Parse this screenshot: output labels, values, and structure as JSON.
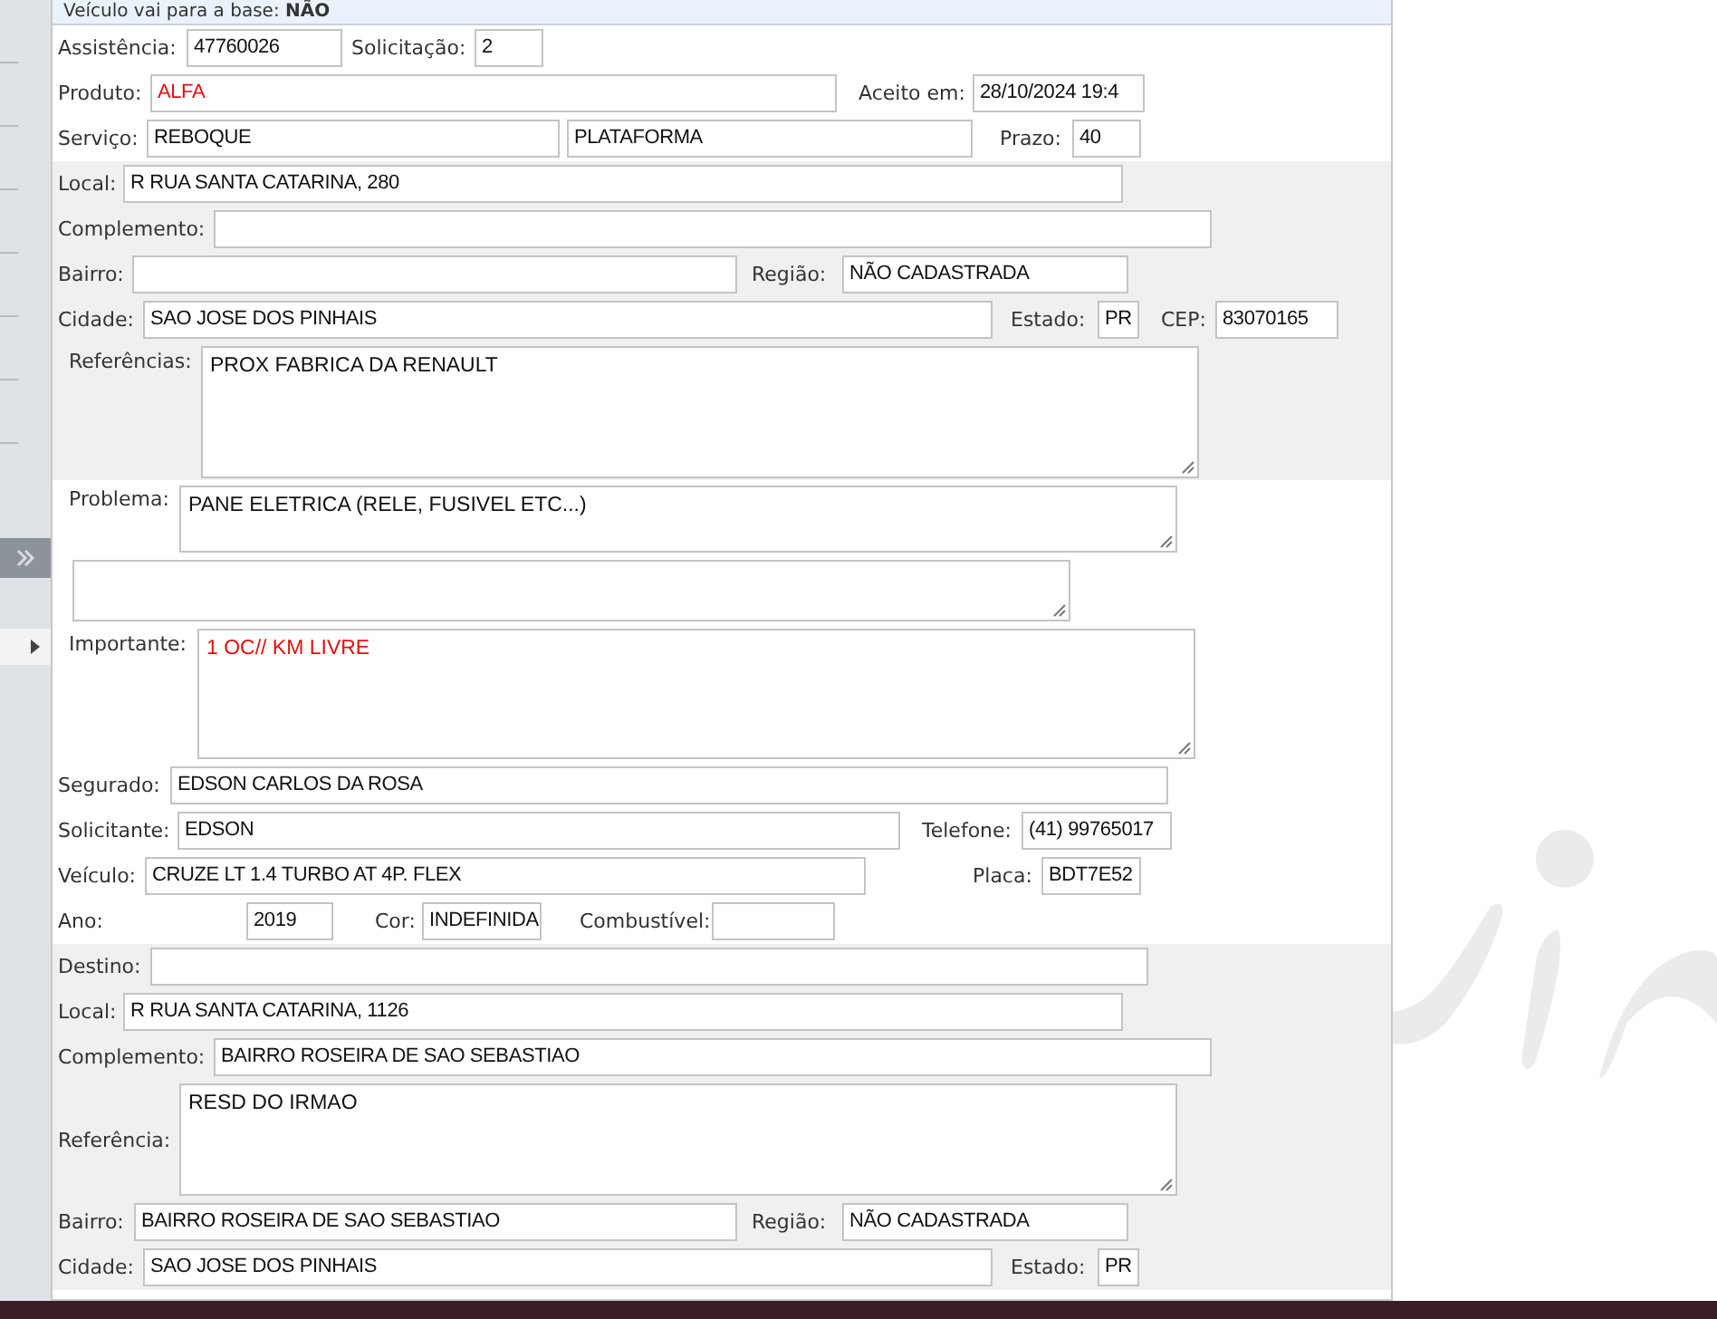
{
  "top_bar": {
    "label": "Veículo vai para a base:",
    "value": "NÃO"
  },
  "sections": [
    {
      "shaded": false,
      "rows": [
        {
          "fields": [
            {
              "label": "Assistência:",
              "value": "47760026",
              "kind": "input",
              "alert": false
            },
            {
              "label": "Solicitação:",
              "value": "2",
              "kind": "input",
              "alert": false
            }
          ]
        },
        {
          "fields": [
            {
              "label": "Produto:",
              "value": "ALFA",
              "kind": "input",
              "alert": true
            },
            {
              "label": "Aceito em:",
              "value": "28/10/2024 19:4",
              "kind": "input",
              "alert": false
            }
          ]
        },
        {
          "fields": [
            {
              "label": "Serviço:",
              "value": "REBOQUE",
              "kind": "input",
              "alert": false
            },
            {
              "value": "PLATAFORMA",
              "kind": "input",
              "alert": false
            },
            {
              "label": "Prazo:",
              "value": "40",
              "kind": "input",
              "alert": false
            }
          ]
        }
      ]
    },
    {
      "shaded": true,
      "rows": [
        {
          "fields": [
            {
              "label": "Local:",
              "value": "R RUA SANTA CATARINA, 280",
              "kind": "input",
              "alert": false
            }
          ]
        },
        {
          "fields": [
            {
              "label": "Complemento:",
              "kind": "input"
            }
          ]
        },
        {
          "fields": [
            {
              "label": "Bairro:",
              "kind": "input"
            },
            {
              "label": "Região:",
              "value": "NÃO CADASTRADA",
              "kind": "input",
              "alert": false
            }
          ]
        },
        {
          "fields": [
            {
              "label": "Cidade:",
              "value": "SAO JOSE DOS PINHAIS",
              "kind": "input",
              "alert": false
            },
            {
              "label": "Estado:",
              "value": "PR",
              "kind": "input",
              "alert": false
            },
            {
              "label": "CEP:",
              "value": "83070165",
              "kind": "input",
              "alert": false
            }
          ]
        },
        {
          "fields": [
            {
              "label": "Referências:",
              "value": "PROX FABRICA DA RENAULT",
              "kind": "textarea",
              "alert": false
            }
          ]
        }
      ]
    },
    {
      "shaded": false,
      "rows": [
        {
          "fields": [
            {
              "label": "Problema:",
              "value": "PANE ELETRICA (RELE, FUSIVEL ETC...)",
              "kind": "textarea",
              "alert": false
            }
          ]
        },
        {
          "fields": [
            {
              "kind": "textarea"
            }
          ]
        },
        {
          "fields": [
            {
              "label": "Importante:",
              "value": "1 OC// KM LIVRE",
              "kind": "textarea",
              "alert": true
            }
          ]
        },
        {
          "fields": [
            {
              "label": "Segurado:",
              "value": "EDSON CARLOS DA ROSA",
              "kind": "input",
              "alert": false
            }
          ]
        },
        {
          "fields": [
            {
              "label": "Solicitante:",
              "value": "EDSON",
              "kind": "input",
              "alert": false
            },
            {
              "label": "Telefone:",
              "value": "(41) 99765017",
              "kind": "input",
              "alert": false
            }
          ]
        },
        {
          "fields": [
            {
              "label": "Veículo:",
              "value": "CRUZE LT 1.4 TURBO AT 4P. FLEX",
              "kind": "input",
              "alert": false
            },
            {
              "label": "Placa:",
              "value": "BDT7E52",
              "kind": "input",
              "alert": false
            }
          ]
        },
        {
          "fields": [
            {
              "label": "Ano:",
              "value": "2019",
              "kind": "input",
              "alert": false
            },
            {
              "label": "Cor:",
              "value": "INDEFINIDA",
              "kind": "input",
              "alert": false
            },
            {
              "label": "Combustível:",
              "kind": "input"
            }
          ]
        }
      ]
    },
    {
      "shaded": true,
      "rows": [
        {
          "fields": [
            {
              "label": "Destino:",
              "kind": "input"
            }
          ]
        },
        {
          "fields": [
            {
              "label": "Local:",
              "value": "R RUA SANTA CATARINA, 1126",
              "kind": "input",
              "alert": false
            }
          ]
        },
        {
          "fields": [
            {
              "label": "Complemento:",
              "value": "BAIRRO ROSEIRA DE SAO SEBASTIAO",
              "kind": "input",
              "alert": false
            }
          ]
        },
        {
          "fields": [
            {
              "label": "Referência:",
              "value": "RESD DO IRMAO",
              "kind": "textarea",
              "alert": false
            }
          ]
        },
        {
          "fields": [
            {
              "label": "Bairro:",
              "value": "BAIRRO ROSEIRA DE SAO SEBASTIAO",
              "kind": "input",
              "alert": false
            },
            {
              "label": "Região:",
              "value": "NÃO CADASTRADA",
              "kind": "input",
              "alert": false
            }
          ]
        },
        {
          "fields": [
            {
              "label": "Cidade:",
              "value": "SAO JOSE DOS PINHAIS",
              "kind": "input",
              "alert": false
            },
            {
              "label": "Estado:",
              "value": "PR",
              "kind": "input",
              "alert": false
            }
          ]
        }
      ]
    }
  ]
}
